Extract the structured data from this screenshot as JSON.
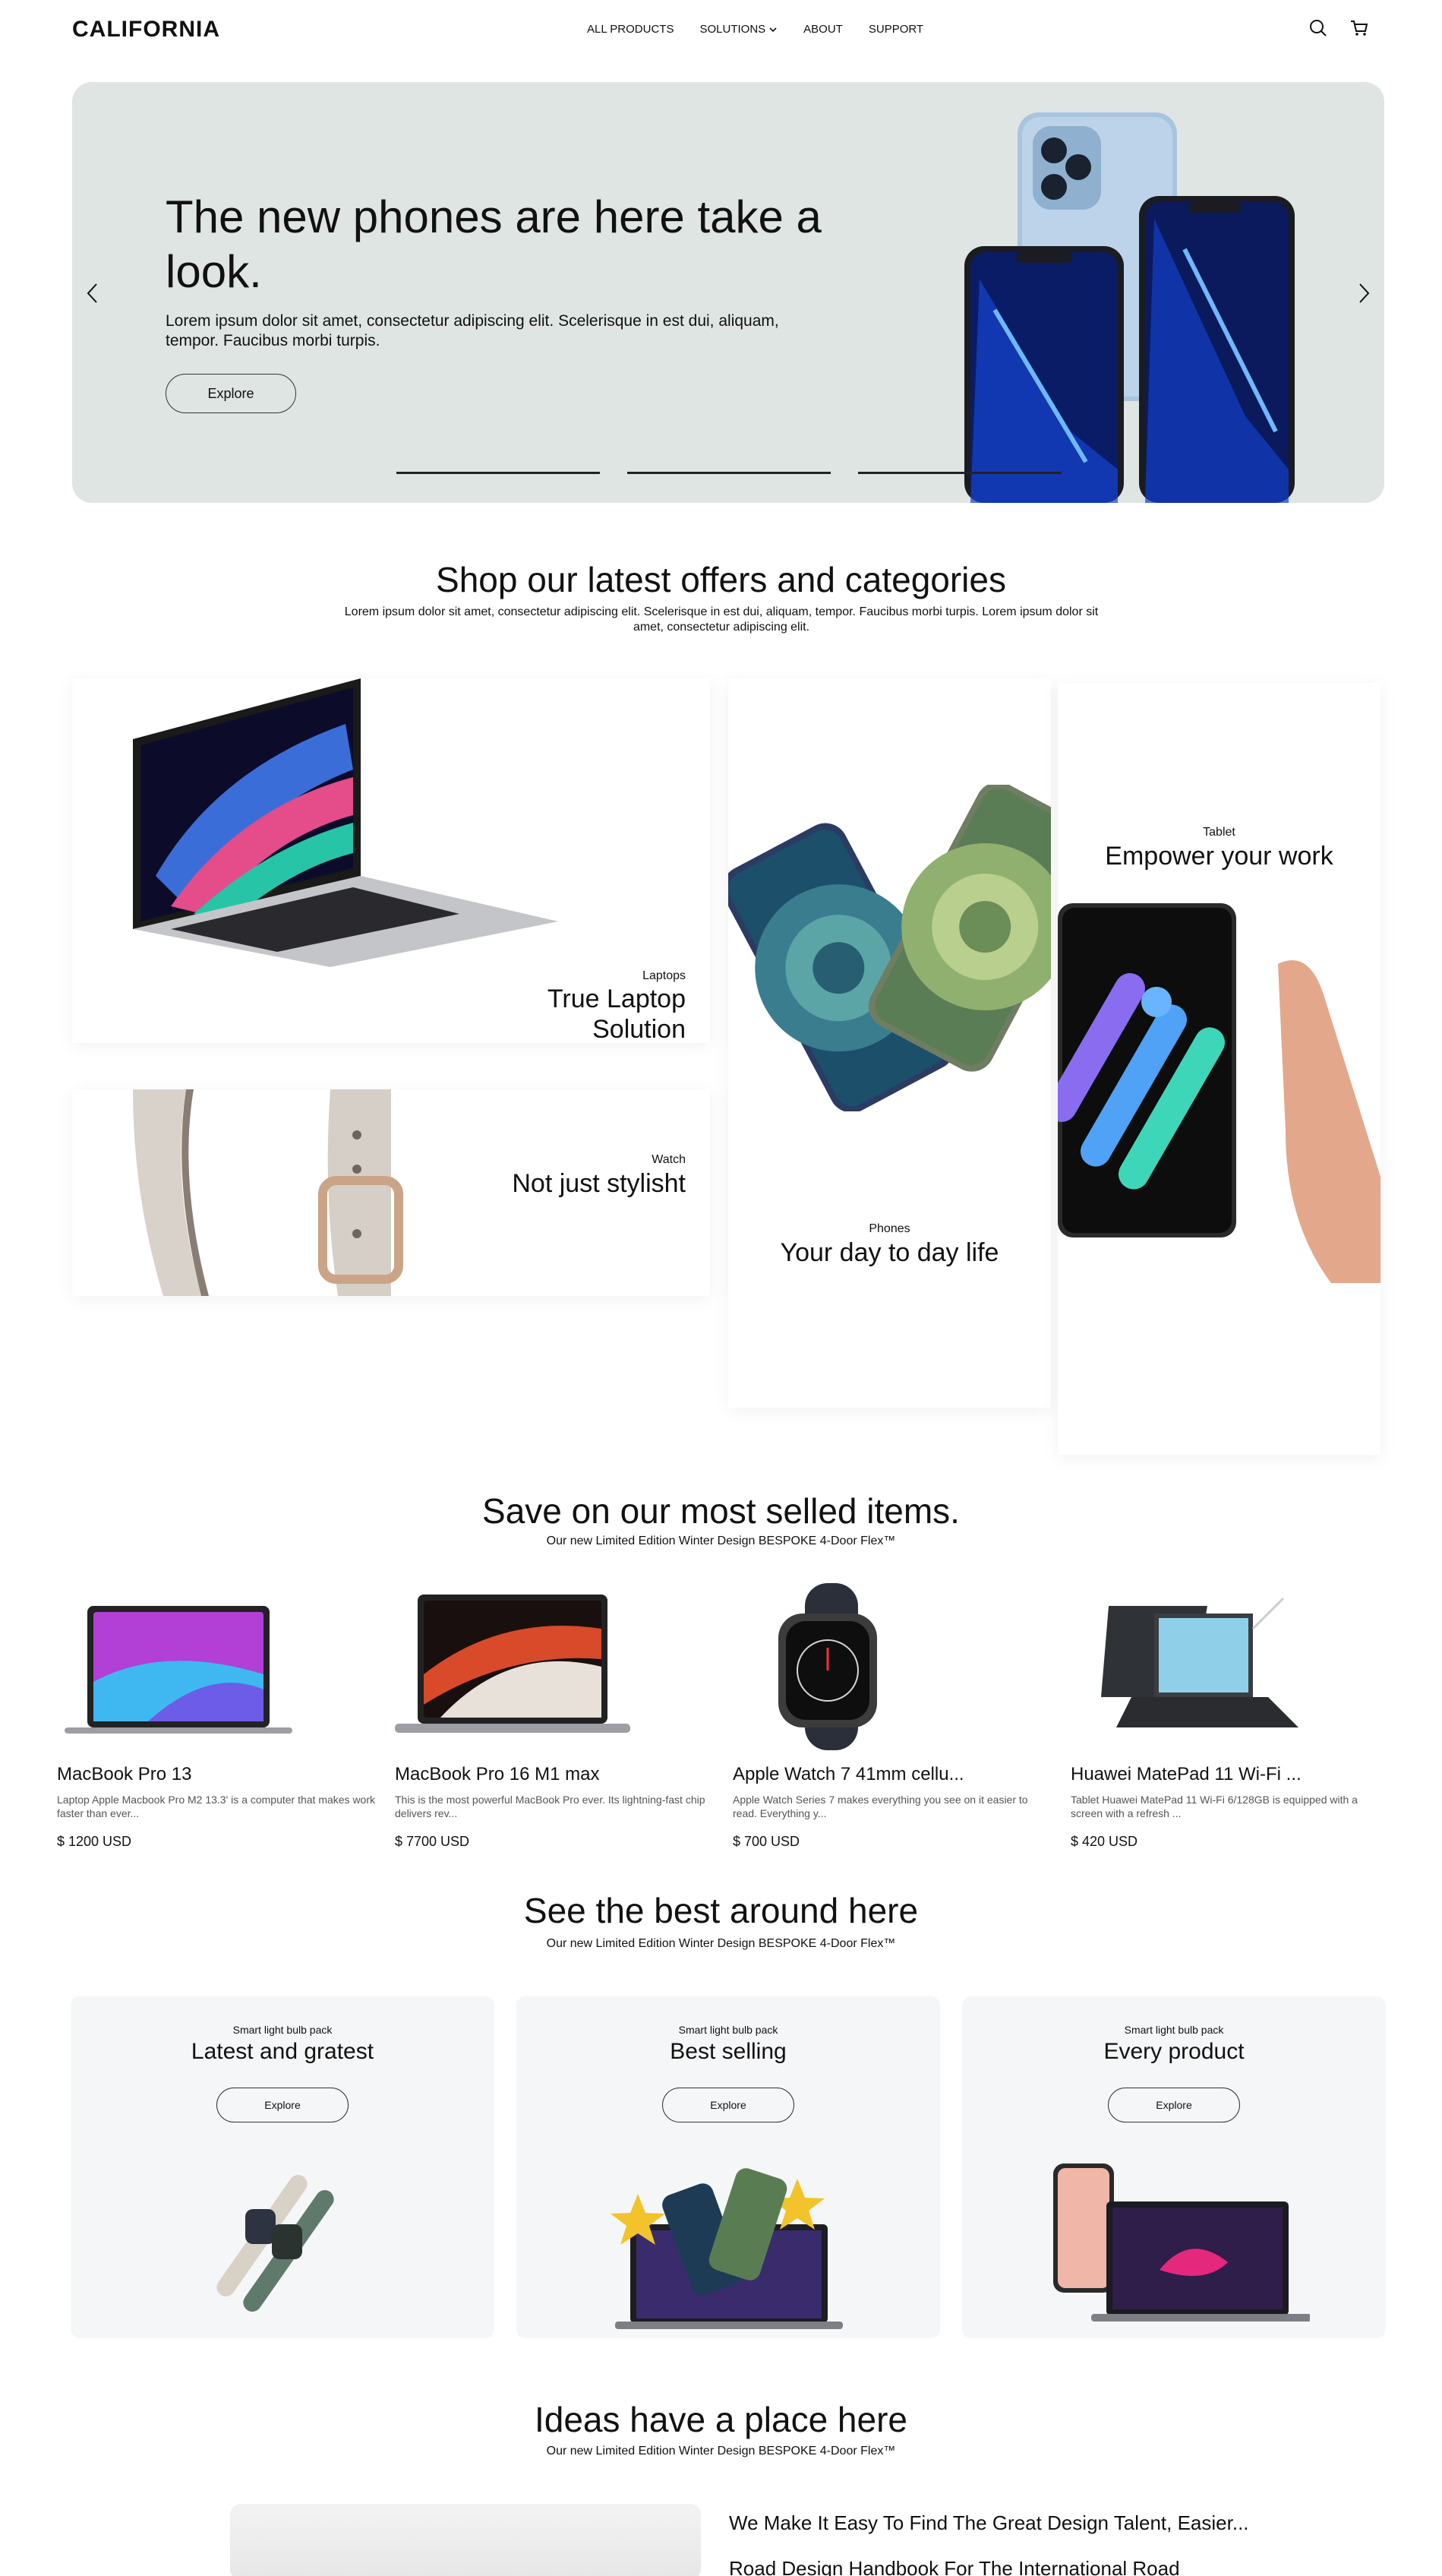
{
  "brand": {
    "logo": "CALIFORNIA"
  },
  "nav": {
    "items": [
      "ALL PRODUCTS",
      "SOLUTIONS",
      "ABOUT",
      "SUPPORT"
    ]
  },
  "hero": {
    "title": "The new phones are here take a look.",
    "subtitle": "Lorem ipsum dolor sit amet, consectetur adipiscing elit. Scelerisque in est dui, aliquam, tempor. Faucibus morbi turpis.",
    "button": "Explore",
    "slide_count": 3,
    "bg_color": "#dfe5e2"
  },
  "categories": {
    "title": "Shop our latest offers and categories",
    "subtitle": "Lorem ipsum dolor sit amet, consectetur adipiscing elit. Scelerisque in est dui, aliquam, tempor. Faucibus morbi turpis. Lorem ipsum dolor sit amet, consectetur adipiscing elit.",
    "laptops": {
      "tag": "Laptops",
      "title": "True Laptop Solution"
    },
    "watch": {
      "tag": "Watch",
      "title": "Not just stylisht"
    },
    "phones": {
      "tag": "Phones",
      "title": "Your day to day life"
    },
    "tablet": {
      "tag": "Tablet",
      "title": "Empower your work"
    }
  },
  "products": {
    "title": "Save on our most selled items.",
    "subtitle": "Our new Limited Edition Winter Design BESPOKE 4-Door Flex™",
    "items": [
      {
        "name": "MacBook Pro 13",
        "desc": "Laptop Apple Macbook Pro M2 13.3' is a computer that makes work faster than ever...",
        "price": "$ 1200 USD"
      },
      {
        "name": "MacBook Pro 16 M1 max",
        "desc": "This is the most powerful MacBook Pro ever. Its lightning-fast chip delivers rev...",
        "price": "$ 7700 USD"
      },
      {
        "name": "Apple Watch 7 41mm cellu...",
        "desc": "Apple Watch Series 7 makes everything you see on it easier to read. Everything y...",
        "price": "$ 700 USD"
      },
      {
        "name": "Huawei MatePad 11 Wi-Fi ...",
        "desc": "Tablet Huawei MatePad 11 Wi-Fi 6/128GB is equipped with a screen with a refresh ...",
        "price": "$ 420 USD"
      }
    ]
  },
  "best": {
    "title": "See the best around here",
    "subtitle": "Our new Limited Edition Winter Design BESPOKE 4-Door Flex™",
    "cards": [
      {
        "tag": "Smart light bulb pack",
        "title": "Latest and gratest",
        "button": "Explore"
      },
      {
        "tag": "Smart light bulb pack",
        "title": "Best selling",
        "button": "Explore"
      },
      {
        "tag": "Smart light bulb pack",
        "title": "Every product",
        "button": "Explore"
      }
    ]
  },
  "ideas": {
    "title": "Ideas have a place here",
    "subtitle": "Our new Limited Edition Winter Design BESPOKE 4-Door Flex™",
    "links": [
      "We Make It Easy To Find The Great Design Talent, Easier...",
      "Road Design Handbook For The International Road"
    ]
  }
}
